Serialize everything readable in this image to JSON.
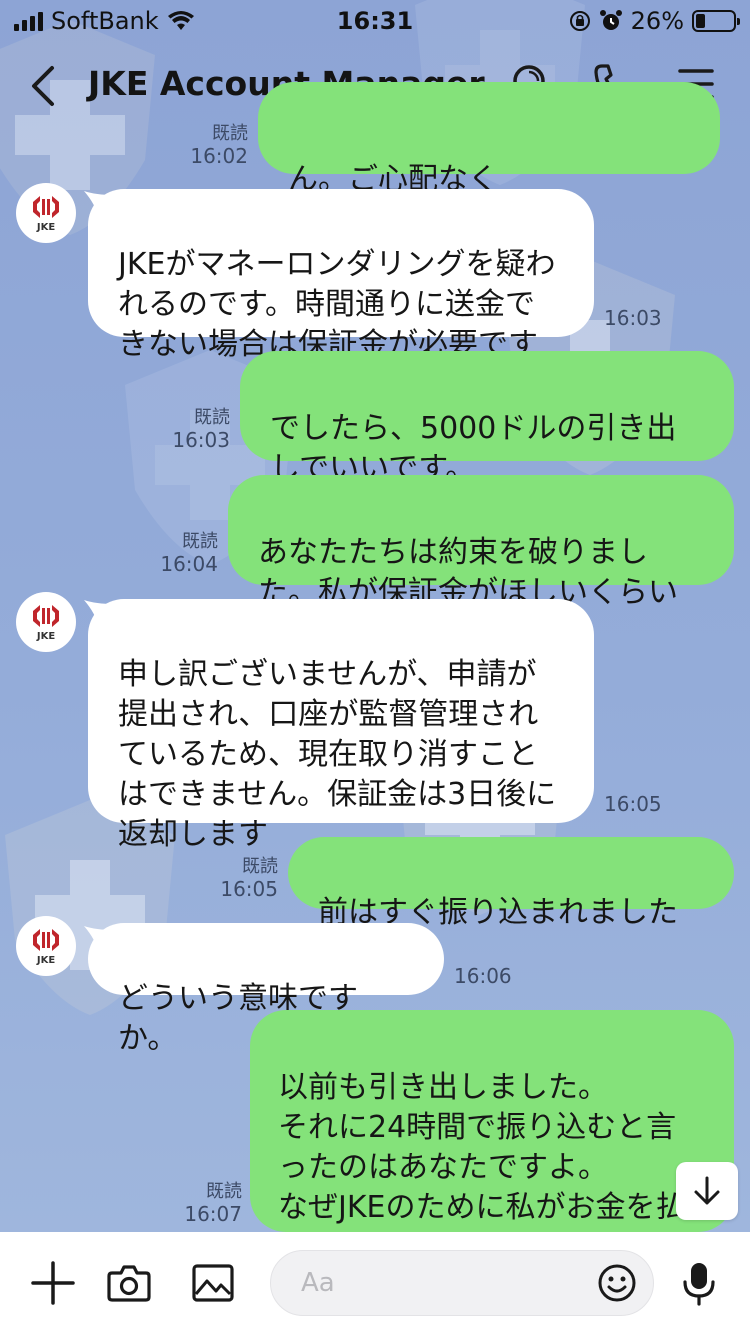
{
  "status_bar": {
    "carrier": "SoftBank",
    "time": "16:31",
    "battery": "26%",
    "battery_level": 0.26
  },
  "header": {
    "title": "JKE Account Manager"
  },
  "contact": {
    "avatar_label": "JKE"
  },
  "messages": [
    {
      "side": "out",
      "text": "ん。ご心配なく",
      "read": "既読",
      "time": "16:02"
    },
    {
      "side": "in",
      "text": "JKEがマネーロンダリングを疑われるのです。時間通りに送金できない場合は保証金が必要です",
      "time": "16:03"
    },
    {
      "side": "out",
      "text": "でしたら、5000ドルの引き出しでいいです。",
      "read": "既読",
      "time": "16:03"
    },
    {
      "side": "out",
      "text": "あなたたちは約束を破りました。私が保証金がほしいくらいです。",
      "read": "既読",
      "time": "16:04"
    },
    {
      "side": "in",
      "text": "申し訳ございませんが、申請が提出され、口座が監督管理されているため、現在取り消すことはできません。保証金は3日後に返却します",
      "time": "16:05"
    },
    {
      "side": "out",
      "text": "前はすぐ振り込まれましたよ",
      "read": "既読",
      "time": "16:05"
    },
    {
      "side": "in",
      "text": "どういう意味ですか。",
      "time": "16:06"
    },
    {
      "side": "out",
      "text": "以前も引き出しました。\nそれに24時間で振り込むと言ったのはあなたですよ。\nなぜJKEのために私がお金を払う？",
      "read": "既読",
      "time": "16:07"
    }
  ],
  "input": {
    "placeholder": "Aa"
  },
  "icons": {
    "back": "chevron-left-icon",
    "search": "search-icon",
    "call": "phone-icon",
    "menu": "hamburger-menu-icon",
    "add": "plus-icon",
    "camera": "camera-icon",
    "image": "image-icon",
    "emoji": "emoji-icon",
    "mic": "microphone-icon",
    "scroll": "arrow-down-icon"
  },
  "colors": {
    "chat_background": "#8ea5d6",
    "outgoing_bubble": "#84e27a",
    "incoming_bubble": "#ffffff",
    "brand_red": "#c0262c"
  }
}
